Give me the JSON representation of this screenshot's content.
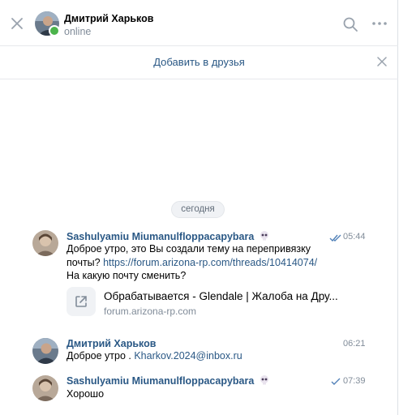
{
  "header": {
    "name": "Дмитрий Харьков",
    "status": "online"
  },
  "add_friend": {
    "label": "Добавить в друзья"
  },
  "date_divider": "сегодня",
  "messages": [
    {
      "author": "Sashulyamiu Miumanulfloppacapybara",
      "time": "05:44",
      "line1": "Доброе утро, это Вы создали тему на перепривязку",
      "line2_prefix": "почты? ",
      "link": "https://forum.arizona-rp.com/threads/10414074/",
      "line3": "На какую почту сменить?",
      "snippet": {
        "title": "Обрабатывается - Glendale | Жалоба на Дру...",
        "subtitle": "forum.arizona-rp.com"
      }
    },
    {
      "author": "Дмитрий Харьков",
      "time": "06:21",
      "text_prefix": "Доброе утро . ",
      "link": "Kharkov.2024@inbox.ru"
    },
    {
      "author": "Sashulyamiu Miumanulfloppacapybara",
      "time": "07:39",
      "text": "Хорошо"
    }
  ],
  "colors": {
    "link": "#2a5885",
    "muted": "#818c99",
    "online": "#4bb34b",
    "read_check": "#5181b8"
  },
  "icons": [
    "close-icon",
    "search-icon",
    "more-icon",
    "external-link-icon",
    "skull-emoji-icon",
    "double-check-icon",
    "check-icon"
  ]
}
